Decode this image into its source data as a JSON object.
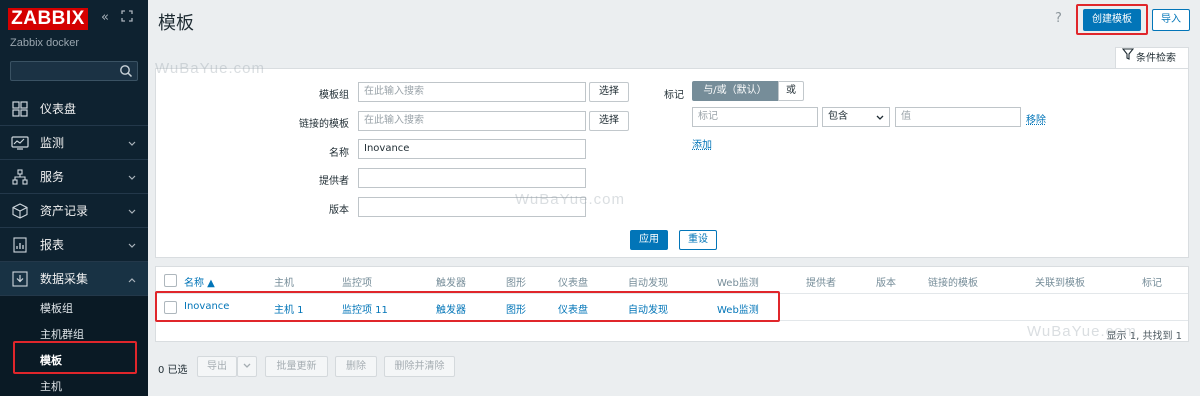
{
  "sidebar": {
    "logo": "ZABBIX",
    "server_name": "Zabbix docker",
    "search_placeholder": "",
    "nav": [
      {
        "label": "仪表盘",
        "icon": "dashboard-icon"
      },
      {
        "label": "监测",
        "icon": "monitoring-icon"
      },
      {
        "label": "服务",
        "icon": "services-icon"
      },
      {
        "label": "资产记录",
        "icon": "inventory-icon"
      },
      {
        "label": "报表",
        "icon": "reports-icon"
      },
      {
        "label": "数据采集",
        "icon": "data-collection-icon"
      }
    ],
    "sub_items": [
      "模板组",
      "主机群组",
      "模板",
      "主机"
    ],
    "active_sub": "模板"
  },
  "header": {
    "title": "模板",
    "help": "?",
    "create_button": "创建模板",
    "import_button": "导入"
  },
  "filter": {
    "tab_label": "条件检索",
    "template_group_label": "模板组",
    "template_group_placeholder": "在此输入搜索",
    "linked_templates_label": "链接的模板",
    "linked_templates_placeholder": "在此输入搜索",
    "select_button": "选择",
    "name_label": "名称",
    "name_value": "Inovance",
    "vendor_label": "提供者",
    "vendor_value": "",
    "version_label": "版本",
    "version_value": "",
    "tags_label": "标记",
    "tag_mode_and": "与/或（默认）",
    "tag_mode_or": "或",
    "tag_placeholder": "标记",
    "tag_operator": "包含",
    "tag_value_placeholder": "值",
    "remove_link": "移除",
    "add_link": "添加",
    "apply_button": "应用",
    "reset_button": "重设"
  },
  "table": {
    "columns": [
      "名称 ▲",
      "主机",
      "监控项",
      "触发器",
      "图形",
      "仪表盘",
      "自动发现",
      "Web监测",
      "提供者",
      "版本",
      "链接的模板",
      "关联到模板",
      "标记"
    ],
    "rows": [
      {
        "name": "Inovance",
        "hosts": "主机 1",
        "items": "监控项 11",
        "triggers": "触发器",
        "graphs": "图形",
        "dashboards": "仪表盘",
        "discovery": "自动发现",
        "web": "Web监测",
        "vendor": "",
        "version": "",
        "linked": "",
        "linked_to": "",
        "tags": ""
      }
    ],
    "paging": "显示 1, 共找到 1"
  },
  "actions": {
    "selected": "0 已选",
    "export": "导出",
    "mass_update": "批量更新",
    "delete": "删除",
    "delete_clear": "删除并清除"
  },
  "watermark": "WuBaYue.com",
  "colors": {
    "sidebar_bg": "#0e2230",
    "accent": "#0275b8",
    "logo_red": "#d40000",
    "highlight_red": "#e0262b"
  }
}
